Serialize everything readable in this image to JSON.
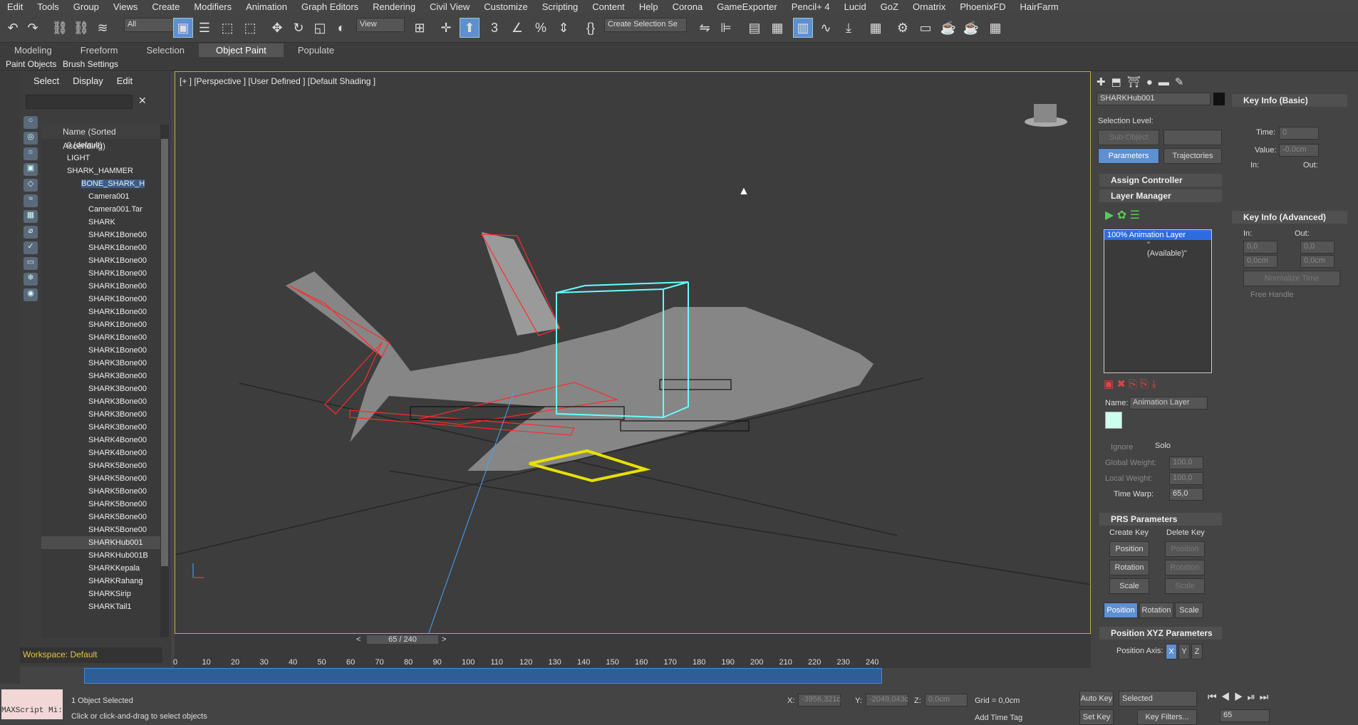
{
  "menu": [
    "Edit",
    "Tools",
    "Group",
    "Views",
    "Create",
    "Modifiers",
    "Animation",
    "Graph Editors",
    "Rendering",
    "Civil View",
    "Customize",
    "Scripting",
    "Content",
    "Help",
    "Corona",
    "GameExporter",
    "Pencil+ 4",
    "Lucid",
    "GoZ",
    "Ornatrix",
    "PhoenixFD",
    "HairFarm"
  ],
  "toolbar": {
    "filter": "All",
    "view": "View",
    "selection_set": "Create Selection Se"
  },
  "ribbon": {
    "tabs": [
      "Modeling",
      "Freeform",
      "Selection",
      "Object Paint",
      "Populate"
    ],
    "active": "Object Paint",
    "sub": [
      "Paint Objects",
      "Brush Settings"
    ]
  },
  "explorer": {
    "menu": [
      "Select",
      "Display",
      "Edit"
    ],
    "header": "Name (Sorted Ascending)",
    "rows": [
      "0 (default)",
      "LIGHT",
      "SHARK_HAMMER",
      "BONE_SHARK_H",
      "Camera001",
      "Camera001.Tar",
      "SHARK",
      "SHARK1Bone00",
      "SHARK1Bone00",
      "SHARK1Bone00",
      "SHARK1Bone00",
      "SHARK1Bone00",
      "SHARK1Bone00",
      "SHARK1Bone00",
      "SHARK1Bone00",
      "SHARK1Bone00",
      "SHARK1Bone00",
      "SHARK3Bone00",
      "SHARK3Bone00",
      "SHARK3Bone00",
      "SHARK3Bone00",
      "SHARK3Bone00",
      "SHARK3Bone00",
      "SHARK4Bone00",
      "SHARK4Bone00",
      "SHARK5Bone00",
      "SHARK5Bone00",
      "SHARK5Bone00",
      "SHARK5Bone00",
      "SHARK5Bone00",
      "SHARK5Bone00",
      "SHARKHub001",
      "SHARKHub001B",
      "SHARKKepala",
      "SHARKRahang",
      "SHARKSirip",
      "SHARKTail1"
    ],
    "workspace": "Workspace: Default"
  },
  "viewport": {
    "label": "[+ ] [Perspective ] [User Defined ] [Default Shading ]"
  },
  "time": {
    "frame": "65 / 240",
    "ticks": [
      "0",
      "10",
      "20",
      "30",
      "40",
      "50",
      "60",
      "70",
      "80",
      "90",
      "100",
      "110",
      "120",
      "130",
      "140",
      "150",
      "160",
      "170",
      "180",
      "190",
      "200",
      "210",
      "220",
      "230",
      "240"
    ],
    "end1": "240",
    "end2": "240",
    "start": "0",
    "cur": "0"
  },
  "cmd": {
    "name": "SHARKHub001",
    "selection_level": "Selection Level:",
    "sub_object": "Sub-Object",
    "parameters": "Parameters",
    "trajectories": "Trajectories",
    "assign": "Assign Controller",
    "layer_mgr": "Layer Manager",
    "layer1": "100% Animation Layer",
    "layer2": "\"(Available)\"",
    "name_lbl": "Name:",
    "name_val": "Animation Layer",
    "ignore": "Ignore",
    "solo": "Solo",
    "gw": "Global Weight:",
    "gw_v": "100,0",
    "lw": "Local Weight:",
    "lw_v": "100,0",
    "tw": "Time Warp:",
    "tw_v": "65,0",
    "prs": "PRS Parameters",
    "create_key": "Create Key",
    "delete_key": "Delete Key",
    "position": "Position",
    "rotation": "Rotation",
    "scale": "Scale",
    "xyz": "Position XYZ Parameters",
    "axis": "Position Axis:",
    "x": "X",
    "y": "Y",
    "z": "Z"
  },
  "keyinfo": {
    "basic": "Key Info (Basic)",
    "time": "Time:",
    "time_v": "0",
    "value": "Value:",
    "value_v": "-0,0cm",
    "in": "In:",
    "out": "Out:",
    "adv": "Key Info (Advanced)",
    "in_v": "0,0",
    "out_v": "0,0",
    "in2": "0,0cm",
    "out2": "0,0cm",
    "norm": "Normalize Time",
    "free": "Free Handle"
  },
  "status": {
    "sel": "1 Object Selected",
    "hint": "Click or click-and-drag to select objects",
    "script": "MAXScript Mi:",
    "x": "X:",
    "x_v": "-3956,321c",
    "y": "Y:",
    "y_v": "-2049,043c",
    "z": "Z:",
    "z_v": "0,0cm",
    "grid": "Grid = 0,0cm",
    "addtag": "Add Time Tag",
    "autokey": "Auto Key",
    "setkey": "Set Key",
    "selected": "Selected",
    "keyfilters": "Key Filters...",
    "frame": "65"
  }
}
